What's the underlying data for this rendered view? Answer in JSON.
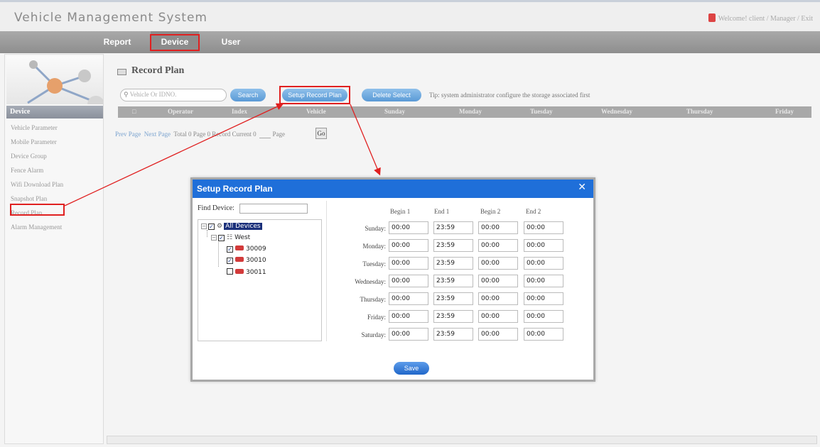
{
  "header": {
    "app_title": "Vehicle Management System",
    "welcome_text": "Welcome!  client / Manager / Exit"
  },
  "nav": {
    "items": [
      {
        "label": "Report"
      },
      {
        "label": "Device"
      },
      {
        "label": "User"
      }
    ],
    "active": "Device"
  },
  "sidebar": {
    "heading": "Device",
    "items": [
      {
        "label": "Vehicle Parameter"
      },
      {
        "label": "Mobile Parameter"
      },
      {
        "label": "Device Group"
      },
      {
        "label": "Fence Alarm"
      },
      {
        "label": "Wifi Download Plan"
      },
      {
        "label": "Snapshot Plan"
      },
      {
        "label": "Record Plan"
      },
      {
        "label": "Alarm Management"
      }
    ],
    "selected": "Record Plan"
  },
  "main": {
    "title": "Record Plan",
    "search": {
      "placeholder": "Vehicle Or IDNO."
    },
    "buttons": {
      "search": "Search",
      "setup": "Setup Record Plan",
      "delete": "Delete Select"
    },
    "tip": "Tip: system administrator configure the storage associated first",
    "table": {
      "columns": [
        "Operator",
        "Index",
        "Vehicle",
        "Sunday",
        "Monday",
        "Tuesday",
        "Wednesday",
        "Thursday",
        "Friday"
      ]
    },
    "pager": {
      "prev": "Prev Page",
      "next": "Next Page",
      "info": "Total 0 Page  0 Record  Current 0",
      "page_label": "Page",
      "go": "Go"
    }
  },
  "dialog": {
    "title": "Setup Record Plan",
    "find_label": "Find Device:",
    "tree": {
      "root": {
        "label": "All Devices",
        "checked": true
      },
      "group": {
        "label": "West",
        "checked": true
      },
      "devices": [
        {
          "label": "30009",
          "checked": true
        },
        {
          "label": "30010",
          "checked": true
        },
        {
          "label": "30011",
          "checked": false
        }
      ]
    },
    "columns": [
      "Begin 1",
      "End 1",
      "Begin 2",
      "End 2"
    ],
    "schedule": [
      {
        "day": "Sunday:",
        "begin1": "00:00",
        "end1": "23:59",
        "begin2": "00:00",
        "end2": "00:00"
      },
      {
        "day": "Monday:",
        "begin1": "00:00",
        "end1": "23:59",
        "begin2": "00:00",
        "end2": "00:00"
      },
      {
        "day": "Tuesday:",
        "begin1": "00:00",
        "end1": "23:59",
        "begin2": "00:00",
        "end2": "00:00"
      },
      {
        "day": "Wednesday:",
        "begin1": "00:00",
        "end1": "23:59",
        "begin2": "00:00",
        "end2": "00:00"
      },
      {
        "day": "Thursday:",
        "begin1": "00:00",
        "end1": "23:59",
        "begin2": "00:00",
        "end2": "00:00"
      },
      {
        "day": "Friday:",
        "begin1": "00:00",
        "end1": "23:59",
        "begin2": "00:00",
        "end2": "00:00"
      },
      {
        "day": "Saturday:",
        "begin1": "00:00",
        "end1": "23:59",
        "begin2": "00:00",
        "end2": "00:00"
      }
    ],
    "save_label": "Save"
  },
  "colors": {
    "dialog_title_bar": "#1f6fd9",
    "annotation": "#e02020",
    "button": "#5a9ad6",
    "nav_bar": "#9a9a9a"
  }
}
